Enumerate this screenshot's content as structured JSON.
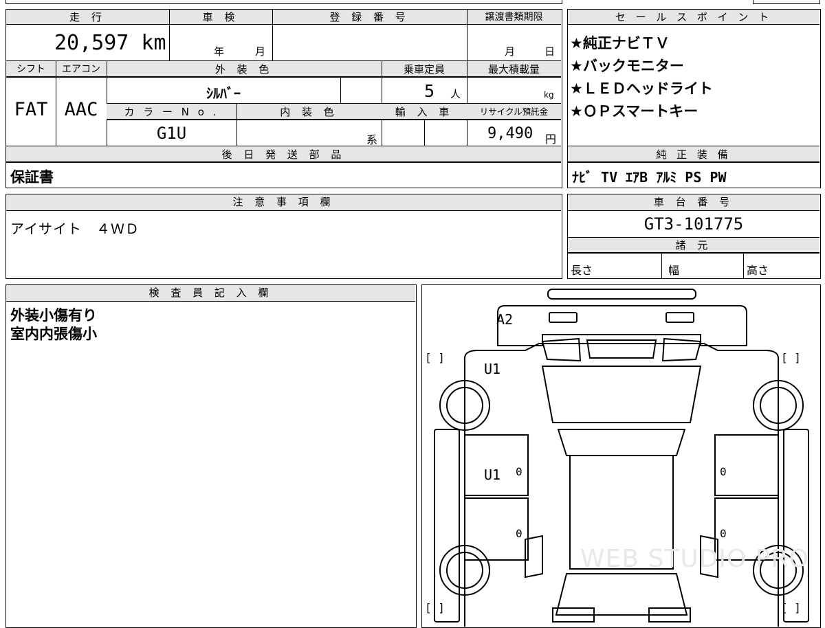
{
  "main": {
    "labels": {
      "mileage": "走 行",
      "inspection": "車 検",
      "registration": "登 録 番 号",
      "transfer_deadline": "譲渡書類期限",
      "shift": "シフト",
      "aircon": "エアコン",
      "exterior_color": "外 装 色",
      "capacity": "乗車定員",
      "max_load": "最大積載量",
      "color_no": "カ ラ ー N o .",
      "interior_color": "内 装 色",
      "import": "輸 入 車",
      "recycle": "リサイクル預託金"
    },
    "values": {
      "mileage": "20,597 km",
      "inspection_year": "年",
      "inspection_month": "月",
      "transfer_month": "月",
      "transfer_day": "日",
      "shift": "FAT",
      "aircon": "AAC",
      "exterior_color": "ｼﾙﾊﾞｰ",
      "capacity": "5",
      "capacity_unit": "人",
      "max_load_unit": "kg",
      "color_no": "G1U",
      "interior_suffix": "系",
      "recycle_amount": "9,490",
      "recycle_unit": "円"
    }
  },
  "parts": {
    "header": "後 日 発 送 部 品",
    "value": "保証書"
  },
  "sales": {
    "header": "セ ー ル ス ポ イ ン ト",
    "points": [
      "★純正ナビＴＶ",
      "★バックモニター",
      "★ＬＥＤヘッドライト",
      "★ＯＰスマートキー"
    ]
  },
  "equipment": {
    "header": "純 正 装 備",
    "value": "ﾅﾋﾞ TV ｴｱB ｱﾙﾐ PS PW"
  },
  "notes": {
    "header": "注 意 事 項 欄",
    "value": "アイサイト　４ＷＤ"
  },
  "chassis": {
    "header": "車 台 番 号",
    "value": "GT3-101775"
  },
  "specs": {
    "header": "諸 元",
    "length": "長さ",
    "width": "幅",
    "height": "高さ"
  },
  "inspector": {
    "header": "検 査 員 記 入 欄",
    "lines": [
      "外装小傷有り",
      "室内内張傷小"
    ]
  },
  "diagram": {
    "mark_a2": "A2",
    "mark_u1_top": "U1",
    "mark_u1_side": "U1",
    "zero": "0",
    "bracket": "[      ]",
    "watermark": "WEB STUDIO PRO"
  }
}
